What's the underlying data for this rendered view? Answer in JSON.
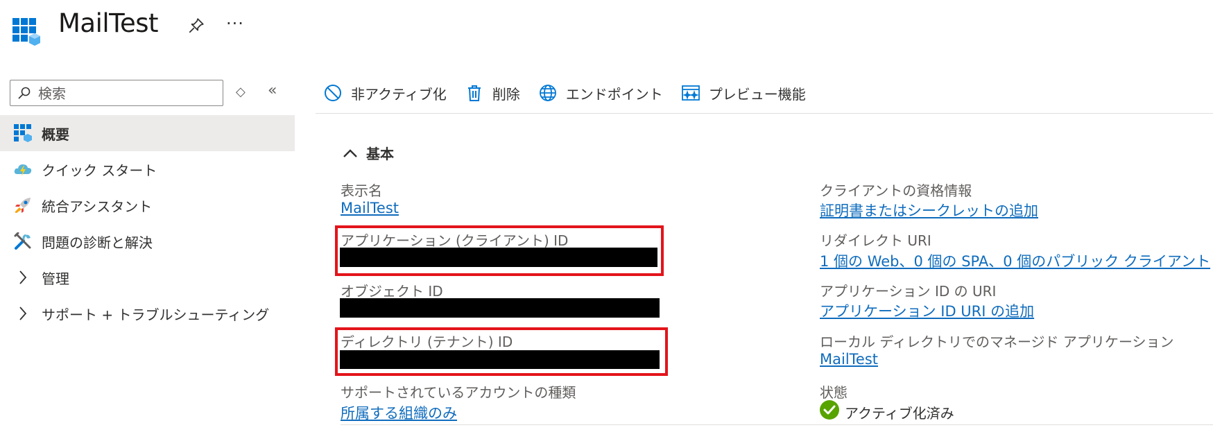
{
  "header": {
    "title": "MailTest",
    "icons": [
      "app-registration-icon",
      "pin-icon",
      "more-icon"
    ],
    "more_label": "···"
  },
  "sidebar": {
    "search_placeholder": "検索",
    "updown_label": "◇",
    "collapse_label": "«",
    "items": [
      {
        "label": "概要",
        "icon": "overview-grid-icon",
        "active": true
      },
      {
        "label": "クイック スタート",
        "icon": "cloud-lightning-icon"
      },
      {
        "label": "統合アシスタント",
        "icon": "rocket-icon"
      },
      {
        "label": "問題の診断と解決",
        "icon": "wrench-icon"
      },
      {
        "label": "管理",
        "icon": "chevron-right-icon",
        "expandable": true
      },
      {
        "label": "サポート + トラブルシューティング",
        "icon": "chevron-right-icon",
        "expandable": true
      }
    ]
  },
  "toolbar": {
    "buttons": [
      {
        "label": "非アクティブ化",
        "icon": "deactivate-icon"
      },
      {
        "label": "削除",
        "icon": "trash-icon"
      },
      {
        "label": "エンドポイント",
        "icon": "globe-icon"
      },
      {
        "label": "プレビュー機能",
        "icon": "preview-features-icon"
      }
    ]
  },
  "essentials": {
    "heading": "基本",
    "left": {
      "display_name_label": "表示名",
      "display_name_value": "MailTest",
      "app_id_label": "アプリケーション (クライアント) ID",
      "object_id_label": "オブジェクト ID",
      "tenant_id_label": "ディレクトリ (テナント) ID",
      "account_types_label": "サポートされているアカウントの種類",
      "account_types_value": "所属する組織のみ"
    },
    "right": {
      "credentials_label": "クライアントの資格情報",
      "credentials_value": "証明書またはシークレットの追加",
      "redirect_label": "リダイレクト URI",
      "redirect_value": "1 個の Web、0 個の SPA、0 個のパブリック クライアント",
      "app_id_uri_label": "アプリケーション ID の URI",
      "app_id_uri_value": "アプリケーション ID URI の追加",
      "managed_app_label": "ローカル ディレクトリでのマネージド アプリケーション",
      "managed_app_value": "MailTest",
      "status_label": "状態",
      "status_value": "アクティブ化済み"
    }
  },
  "colors": {
    "link": "#0f6cbd",
    "highlight_border": "#e3141b",
    "status_green": "#57a300",
    "active_nav_bg": "#edebe9"
  }
}
